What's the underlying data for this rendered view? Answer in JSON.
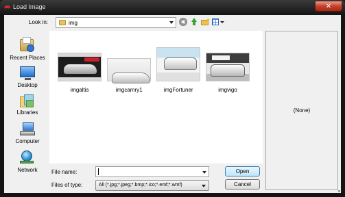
{
  "window": {
    "title": "Load Image",
    "close_symbol": "✕"
  },
  "toolbar": {
    "lookin_label": "Look in:",
    "lookin_value": "img",
    "back_icon": "back-icon",
    "up_icon": "up-folder-icon",
    "newfolder_icon": "new-folder-icon",
    "view_icon": "view-menu-icon"
  },
  "places": [
    {
      "label": "Recent Places",
      "icon": "recent-places-icon"
    },
    {
      "label": "Desktop",
      "icon": "desktop-icon"
    },
    {
      "label": "Libraries",
      "icon": "libraries-icon"
    },
    {
      "label": "Computer",
      "icon": "computer-icon"
    },
    {
      "label": "Network",
      "icon": "network-icon"
    }
  ],
  "files": [
    {
      "name": "imgaltis"
    },
    {
      "name": "imgcamry1"
    },
    {
      "name": "imgFortuner"
    },
    {
      "name": "imgvigo"
    }
  ],
  "preview": {
    "text": "(None)"
  },
  "form": {
    "filename_label": "File name:",
    "filename_value": "",
    "filetype_label": "Files of type:",
    "filetype_value": "All (*.jpg;*.jpeg;*.bmp;*.ico;*.emf;*.wmf)"
  },
  "buttons": {
    "open": "Open",
    "cancel": "Cancel"
  },
  "colors": {
    "title_bar": "#141414",
    "close_button": "#c8412b",
    "client_bg": "#f0f0f0",
    "open_button_border": "#3c7fb1"
  }
}
